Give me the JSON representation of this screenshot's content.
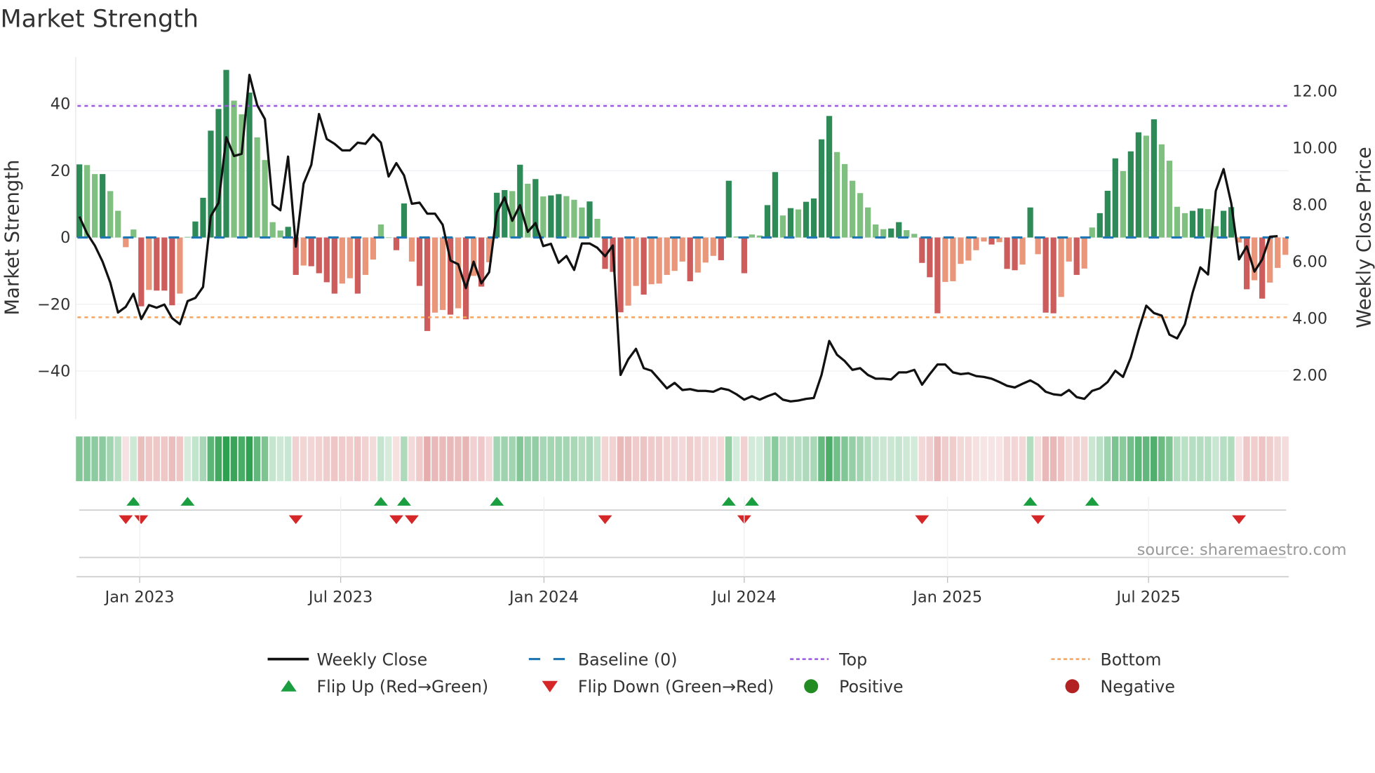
{
  "title": "Market Strength",
  "source": "source: sharemaestro.com",
  "colors": {
    "pos_rising": "#2e8b57",
    "pos_falling": "#7fbf7f",
    "neg_rising": "#cd5c5c",
    "neg_falling": "#e9967a",
    "top": "#9b59e0",
    "bottom": "#f4a460",
    "baseline": "#1f77b4",
    "line": "#111111",
    "flip_up": "#1a9e3f",
    "flip_down": "#d62728",
    "positive": "#228b22",
    "negative": "#b22222"
  },
  "legend": [
    {
      "label": "Weekly Close",
      "icon": "solid-line"
    },
    {
      "label": "Baseline (0)",
      "icon": "dashed-line"
    },
    {
      "label": "Top",
      "icon": "dotted-line"
    },
    {
      "label": "Bottom",
      "icon": "dotted-line"
    },
    {
      "label": "Flip Up (Red→Green)",
      "icon": "triangle-up"
    },
    {
      "label": "Flip Down (Green→Red)",
      "icon": "triangle-down"
    },
    {
      "label": "Positive",
      "icon": "circle"
    },
    {
      "label": "Negative",
      "icon": "circle"
    }
  ],
  "chart_data": {
    "type": "bar",
    "title": "Market Strength",
    "ylabel": "Market Strength",
    "y2label": "Weekly Close Price",
    "ylim": [
      -54,
      56
    ],
    "y2lim": [
      0,
      13.6
    ],
    "yticks": [
      {
        "v": 40,
        "label": "40"
      },
      {
        "v": 20,
        "label": "20"
      },
      {
        "v": 0,
        "label": "0"
      },
      {
        "v": -20,
        "label": "−20"
      },
      {
        "v": -40,
        "label": "−40"
      }
    ],
    "y2ticks": [
      {
        "v": 12,
        "label": "12.00"
      },
      {
        "v": 10,
        "label": "10.00"
      },
      {
        "v": 8,
        "label": "8.00"
      },
      {
        "v": 6,
        "label": "6.00"
      },
      {
        "v": 4,
        "label": "4.00"
      },
      {
        "v": 2,
        "label": "2.00"
      }
    ],
    "xticks": [
      {
        "week": 7.8,
        "label": "Jan 2023"
      },
      {
        "week": 33.8,
        "label": "Jul 2023"
      },
      {
        "week": 60.1,
        "label": "Jan 2024"
      },
      {
        "week": 86.0,
        "label": "Jul 2024"
      },
      {
        "week": 112.3,
        "label": "Jan 2025"
      },
      {
        "week": 138.3,
        "label": "Jul 2025"
      }
    ],
    "top_level": 39.4,
    "bottom_level": -23.9,
    "strength": [
      21.9,
      21.7,
      19,
      19,
      13.9,
      8,
      -2.9,
      2.4,
      -20.6,
      -15.7,
      -15.9,
      -15.9,
      -20.3,
      -16.8,
      0.2,
      4.8,
      11.9,
      32,
      38.5,
      50.2,
      41,
      36.9,
      43.4,
      30,
      23.2,
      4.6,
      2.1,
      3.2,
      -11.2,
      -8.4,
      -8.6,
      -10.7,
      -13.4,
      -16.8,
      -13.8,
      -12.2,
      -16.8,
      -11.2,
      -6.6,
      3.9,
      0,
      -3.8,
      10.2,
      -7.2,
      -14.5,
      -28,
      -22.5,
      -21.7,
      -23.1,
      -21.2,
      -24.5,
      -11.5,
      -14.7,
      -7.4,
      13.4,
      14.2,
      13.9,
      21.8,
      16.1,
      17.5,
      12.3,
      12.6,
      13,
      12.4,
      11.3,
      9,
      10.8,
      5.6,
      -9.4,
      -10.3,
      -22.4,
      -20.4,
      -14.5,
      -17.1,
      -14,
      -13.8,
      -11.2,
      -10,
      -7.2,
      -13.1,
      -10.5,
      -7.5,
      -5.5,
      -6.8,
      17,
      0.3,
      -10.7,
      0.9,
      0.6,
      9.7,
      19.6,
      6.6,
      8.8,
      8.4,
      10.7,
      11.7,
      29.4,
      36.4,
      25.6,
      22,
      17,
      13.3,
      9,
      3.9,
      2.5,
      2.7,
      4.6,
      2.2,
      1.1,
      -7.6,
      -11.9,
      -22.7,
      -13.3,
      -13.1,
      -7.9,
      -6.9,
      -3.8,
      -1.2,
      -2.1,
      -1.4,
      -9.4,
      -9.8,
      -8.1,
      9,
      -5,
      -22.5,
      -22.7,
      -17.8,
      -7.2,
      -11.2,
      -9.3,
      3,
      7.3,
      14,
      23.7,
      19.9,
      25.8,
      31.5,
      30.5,
      35.4,
      27.9,
      23,
      9.2,
      7.3,
      8,
      8.7,
      8.5,
      3.4,
      8,
      9.1,
      -1.5,
      -15.5,
      -12.8,
      -18.3,
      -13.5,
      -9.1,
      -5.2
    ],
    "shade": "ddldlldddldddldddddllldllllddldddllldllddddddlldldldlddldldldd",
    "shade_note": "d = strengthening (dark), l = weakening (light)",
    "weekly_close": [
      7.56,
      6.96,
      6.54,
      5.97,
      5.23,
      4.18,
      4.38,
      4.84,
      3.95,
      4.44,
      4.35,
      4.46,
      3.98,
      3.77,
      4.58,
      4.69,
      5.08,
      7.57,
      8.04,
      10.35,
      9.69,
      9.77,
      12.55,
      11.48,
      10.99,
      7.98,
      7.78,
      9.67,
      6.5,
      8.72,
      9.38,
      11.17,
      10.29,
      10.12,
      9.89,
      9.89,
      10.16,
      10.12,
      10.45,
      10.16,
      8.97,
      9.44,
      9.01,
      8.01,
      8.05,
      7.66,
      7.66,
      7.27,
      6.01,
      5.88,
      5.04,
      5.97,
      5.21,
      5.6,
      7.7,
      8.23,
      7.41,
      7.96,
      7.02,
      7.33,
      6.52,
      6.6,
      5.93,
      6.17,
      5.68,
      6.61,
      6.61,
      6.46,
      6.16,
      6.54,
      1.98,
      2.53,
      2.9,
      2.22,
      2.13,
      1.82,
      1.51,
      1.7,
      1.45,
      1.48,
      1.42,
      1.42,
      1.39,
      1.51,
      1.45,
      1.3,
      1.11,
      1.23,
      1.11,
      1.23,
      1.33,
      1.11,
      1.05,
      1.08,
      1.14,
      1.17,
      1.98,
      3.18,
      2.69,
      2.47,
      2.16,
      2.22,
      1.98,
      1.85,
      1.85,
      1.82,
      2.07,
      2.07,
      2.16,
      1.64,
      2.01,
      2.35,
      2.35,
      2.07,
      2.01,
      2.04,
      1.94,
      1.91,
      1.85,
      1.73,
      1.6,
      1.54,
      1.67,
      1.79,
      1.64,
      1.39,
      1.3,
      1.27,
      1.45,
      1.2,
      1.14,
      1.42,
      1.51,
      1.73,
      2.13,
      1.91,
      2.59,
      3.55,
      4.42,
      4.16,
      4.07,
      3.4,
      3.27,
      3.77,
      4.88,
      5.77,
      5.52,
      8.46,
      9.23,
      8.02,
      6.05,
      6.51,
      5.62,
      6.05,
      6.85,
      6.87
    ],
    "flip_up_weeks": [
      7,
      14,
      39,
      42,
      54,
      84,
      87,
      123,
      131
    ],
    "flip_down_weeks": [
      6,
      8,
      28,
      41,
      43,
      68,
      86,
      109,
      124,
      150
    ]
  }
}
